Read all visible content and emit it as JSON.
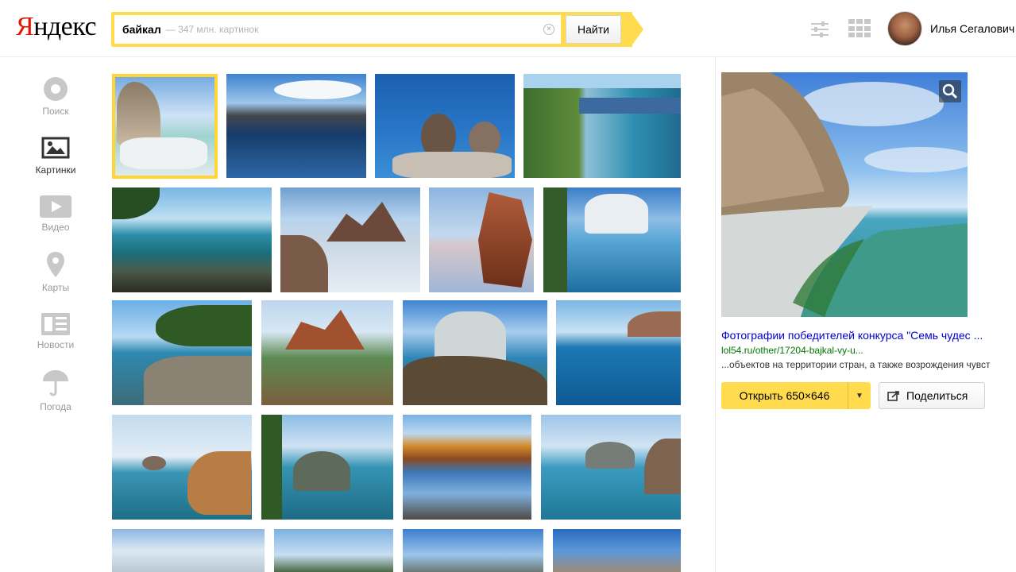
{
  "header": {
    "logo_first": "Я",
    "logo_rest": "ндекс",
    "search_query": "байкал",
    "search_hint": "— 347 млн. картинок",
    "search_button": "Найти",
    "username": "Илья Сегалович"
  },
  "sidebar": {
    "items": [
      {
        "label": "Поиск",
        "icon": "search-circle-icon"
      },
      {
        "label": "Картинки",
        "icon": "images-icon"
      },
      {
        "label": "Видео",
        "icon": "video-icon"
      },
      {
        "label": "Карты",
        "icon": "map-pin-icon"
      },
      {
        "label": "Новости",
        "icon": "news-icon"
      },
      {
        "label": "Погода",
        "icon": "umbrella-icon"
      }
    ]
  },
  "preview": {
    "title": "Фотографии победителей конкурса \"Семь чудес ...",
    "url": "lol54.ru/other/17204-bajkal-vy-u...",
    "description": "...объектов на территории стран, а также возрождения чувст",
    "open_button": "Открыть 650×646",
    "share_button": "Поделиться"
  },
  "colors": {
    "brand_yellow": "#ffdb4d",
    "logo_red": "#e61400",
    "link_blue": "#0000cc",
    "url_green": "#007700"
  }
}
